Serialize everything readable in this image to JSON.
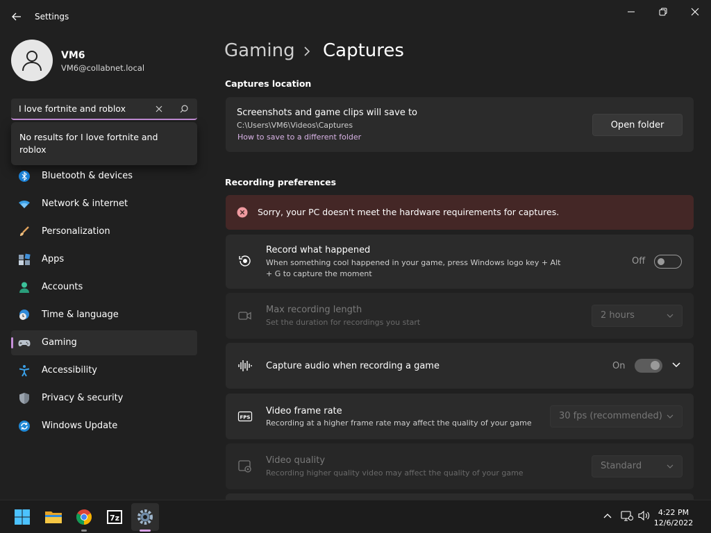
{
  "window": {
    "title": "Settings",
    "buttons": [
      "minimize",
      "restore",
      "close"
    ]
  },
  "profile": {
    "name": "VM6",
    "email": "VM6@collabnet.local"
  },
  "search": {
    "value": "I  love fortnite and roblox",
    "no_results": "No results for I  love fortnite and roblox"
  },
  "nav": [
    {
      "label": "Bluetooth & devices",
      "icon": "bluetooth-icon"
    },
    {
      "label": "Network & internet",
      "icon": "wifi-icon"
    },
    {
      "label": "Personalization",
      "icon": "brush-icon"
    },
    {
      "label": "Apps",
      "icon": "apps-icon"
    },
    {
      "label": "Accounts",
      "icon": "person-icon"
    },
    {
      "label": "Time & language",
      "icon": "globe-clock-icon"
    },
    {
      "label": "Gaming",
      "icon": "controller-icon",
      "active": true
    },
    {
      "label": "Accessibility",
      "icon": "accessibility-icon"
    },
    {
      "label": "Privacy & security",
      "icon": "shield-icon"
    },
    {
      "label": "Windows Update",
      "icon": "update-icon"
    }
  ],
  "breadcrumb": {
    "parent": "Gaming",
    "current": "Captures"
  },
  "captures_location": {
    "section_title": "Captures location",
    "title": "Screenshots and game clips will save to",
    "path": "C:\\Users\\VM6\\Videos\\Captures",
    "link": "How to save to a different folder",
    "button": "Open folder"
  },
  "recording": {
    "section_title": "Recording preferences",
    "error": "Sorry, your PC doesn't meet the hardware requirements for captures.",
    "record_what_happened": {
      "title": "Record what happened",
      "subtitle": "When something cool happened in your game, press Windows logo key + Alt + G to capture the moment",
      "state": "Off"
    },
    "max_length": {
      "title": "Max recording length",
      "subtitle": "Set the duration for recordings you start",
      "value": "2 hours"
    },
    "capture_audio": {
      "title": "Capture audio when recording a game",
      "state": "On"
    },
    "frame_rate": {
      "title": "Video frame rate",
      "subtitle": "Recording at a higher frame rate may affect the quality of your game",
      "value": "30 fps (recommended)"
    },
    "quality": {
      "title": "Video quality",
      "subtitle": "Recording higher quality video may affect the quality of your game",
      "value": "Standard"
    }
  },
  "taskbar": {
    "apps": [
      "start-icon",
      "file-explorer-icon",
      "chrome-icon",
      "7zip-icon",
      "settings-icon"
    ],
    "time": "4:22 PM",
    "date": "12/6/2022"
  },
  "colors": {
    "accent": "#c58fd8",
    "background": "#202020",
    "card": "#2b2b2b",
    "error_bg": "#442726"
  }
}
